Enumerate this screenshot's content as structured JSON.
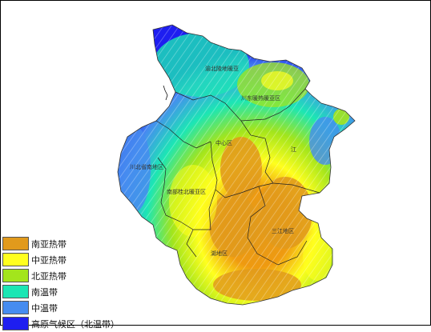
{
  "legend": [
    {
      "label": "南亚热带",
      "color": "#e19a1c"
    },
    {
      "label": "中亚热带",
      "color": "#ffff1e"
    },
    {
      "label": "北亚热带",
      "color": "#a3e51c"
    },
    {
      "label": "南温带",
      "color": "#1ce6b4"
    },
    {
      "label": "中温带",
      "color": "#468cf0"
    },
    {
      "label": "高原气候区（北温带）",
      "color": "#1e1ef0"
    }
  ],
  "regions": [
    {
      "label": "渝北陵地暖亚"
    },
    {
      "label": "川东暖热暖亚区"
    },
    {
      "label": "中心区"
    },
    {
      "label": "江"
    },
    {
      "label": "川北省南地区"
    },
    {
      "label": "南部桂北暖亚区"
    },
    {
      "label": "三江地区"
    },
    {
      "label": "湖地区"
    }
  ]
}
